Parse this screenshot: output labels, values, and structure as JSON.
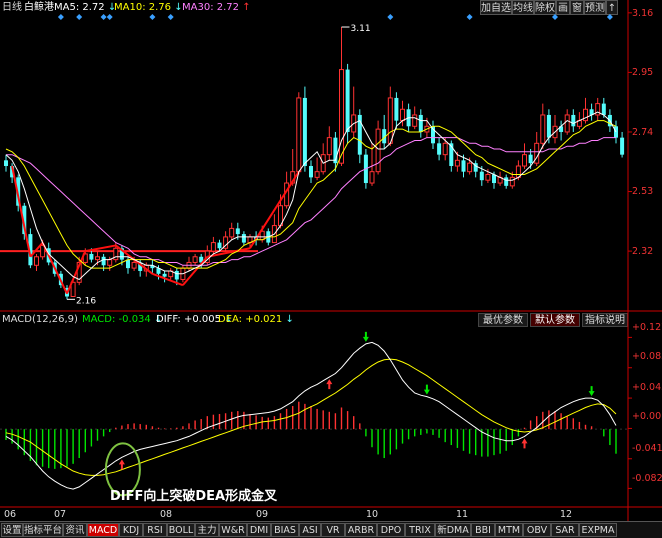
{
  "header": {
    "period": "日线",
    "stock_name": "白鲸港",
    "ma5_label": "MA5:",
    "ma5_value": "2.72",
    "ma10_label": "MA10:",
    "ma10_value": "2.76",
    "ma30_label": "MA30:",
    "ma30_value": "2.72",
    "buttons": [
      "加自选",
      "均线",
      "除权",
      "画",
      "窗",
      "预测"
    ]
  },
  "price_axis": [
    "3.16",
    "2.95",
    "2.74",
    "2.53",
    "2.32"
  ],
  "price_markers": {
    "high": "3.11",
    "low": "2.16"
  },
  "macd_header": {
    "title": "MACD(12,26,9)",
    "macd_label": "MACD:",
    "macd_value": "-0.034",
    "diff_label": "DIFF:",
    "diff_value": "+0.005",
    "dea_label": "DEA:",
    "dea_value": "+0.021",
    "param_buttons": [
      "最优参数",
      "默认参数",
      "指标说明"
    ]
  },
  "macd_axis": [
    "+0.127",
    "+0.085",
    "+0.043",
    "+0.001",
    "-0.041",
    "-0.082"
  ],
  "date_axis": [
    "06",
    "07",
    "08",
    "09",
    "10",
    "11",
    "12"
  ],
  "annotation": "DIFF向上突破DEA形成金叉",
  "bottom_tabs": [
    "设置",
    "指标平台",
    "资讯",
    "MACD",
    "KDJ",
    "RSI",
    "BOLL",
    "主力",
    "W&R",
    "DMI",
    "BIAS",
    "ASI",
    "VR",
    "ARBR",
    "DPO",
    "TRIX",
    "新DMA",
    "BBI",
    "MTM",
    "OBV",
    "SAR",
    "EXPMA"
  ],
  "active_tab": "MACD",
  "colors": {
    "up": "#ff3232",
    "down": "#54fcfc",
    "ma5": "#ffffff",
    "ma10": "#ffff00",
    "ma30": "#ff80ff",
    "macd_up": "#ff3232",
    "macd_down": "#00e600",
    "signal_up": "#ff3232",
    "signal_down": "#00e600",
    "circle": "#7fc241"
  },
  "chart_data": [
    {
      "type": "candlestick",
      "title": "",
      "yaxis_ticks": [
        3.16,
        2.95,
        2.74,
        2.53,
        2.32
      ],
      "ylim": [
        2.13,
        3.17
      ],
      "x_tick_labels": [
        "06",
        "07",
        "08",
        "09",
        "10",
        "11",
        "12"
      ],
      "candles": [
        [
          2.64,
          2.62,
          2.66,
          2.6
        ],
        [
          2.62,
          2.58,
          2.63,
          2.56
        ],
        [
          2.58,
          2.48,
          2.59,
          2.46
        ],
        [
          2.48,
          2.38,
          2.49,
          2.36
        ],
        [
          2.38,
          2.27,
          2.4,
          2.26
        ],
        [
          2.27,
          2.3,
          2.31,
          2.25
        ],
        [
          2.3,
          2.34,
          2.36,
          2.29
        ],
        [
          2.33,
          2.28,
          2.35,
          2.27
        ],
        [
          2.28,
          2.24,
          2.29,
          2.23
        ],
        [
          2.24,
          2.2,
          2.25,
          2.19
        ],
        [
          2.19,
          2.16,
          2.2,
          2.15
        ],
        [
          2.16,
          2.21,
          2.22,
          2.16
        ],
        [
          2.21,
          2.28,
          2.3,
          2.2
        ],
        [
          2.28,
          2.31,
          2.33,
          2.27
        ],
        [
          2.31,
          2.29,
          2.33,
          2.28
        ],
        [
          2.29,
          2.3,
          2.32,
          2.27
        ],
        [
          2.3,
          2.27,
          2.31,
          2.25
        ],
        [
          2.27,
          2.29,
          2.3,
          2.25
        ],
        [
          2.29,
          2.33,
          2.35,
          2.28
        ],
        [
          2.33,
          2.29,
          2.34,
          2.27
        ],
        [
          2.29,
          2.26,
          2.3,
          2.24
        ],
        [
          2.26,
          2.28,
          2.3,
          2.25
        ],
        [
          2.28,
          2.25,
          2.29,
          2.23
        ],
        [
          2.25,
          2.27,
          2.28,
          2.23
        ],
        [
          2.27,
          2.26,
          2.29,
          2.24
        ],
        [
          2.26,
          2.24,
          2.27,
          2.22
        ],
        [
          2.24,
          2.23,
          2.25,
          2.21
        ],
        [
          2.23,
          2.25,
          2.26,
          2.22
        ],
        [
          2.25,
          2.22,
          2.26,
          2.2
        ],
        [
          2.22,
          2.26,
          2.27,
          2.21
        ],
        [
          2.26,
          2.28,
          2.3,
          2.25
        ],
        [
          2.28,
          2.3,
          2.31,
          2.27
        ],
        [
          2.3,
          2.28,
          2.31,
          2.26
        ],
        [
          2.28,
          2.32,
          2.34,
          2.27
        ],
        [
          2.32,
          2.35,
          2.37,
          2.31
        ],
        [
          2.35,
          2.33,
          2.36,
          2.32
        ],
        [
          2.33,
          2.37,
          2.39,
          2.32
        ],
        [
          2.37,
          2.4,
          2.42,
          2.36
        ],
        [
          2.4,
          2.38,
          2.42,
          2.36
        ],
        [
          2.38,
          2.35,
          2.39,
          2.34
        ],
        [
          2.35,
          2.37,
          2.38,
          2.33
        ],
        [
          2.37,
          2.36,
          2.39,
          2.34
        ],
        [
          2.36,
          2.39,
          2.41,
          2.35
        ],
        [
          2.39,
          2.35,
          2.4,
          2.34
        ],
        [
          2.35,
          2.41,
          2.45,
          2.35
        ],
        [
          2.41,
          2.48,
          2.52,
          2.4
        ],
        [
          2.48,
          2.56,
          2.6,
          2.47
        ],
        [
          2.56,
          2.6,
          2.68,
          2.55
        ],
        [
          2.6,
          2.86,
          2.88,
          2.59
        ],
        [
          2.86,
          2.62,
          2.9,
          2.6
        ],
        [
          2.62,
          2.58,
          2.64,
          2.56
        ],
        [
          2.58,
          2.6,
          2.65,
          2.57
        ],
        [
          2.6,
          2.66,
          2.7,
          2.59
        ],
        [
          2.66,
          2.72,
          2.76,
          2.64
        ],
        [
          2.72,
          2.63,
          2.74,
          2.6
        ],
        [
          2.63,
          2.96,
          3.11,
          2.62
        ],
        [
          2.96,
          2.74,
          2.98,
          2.7
        ],
        [
          2.74,
          2.8,
          2.9,
          2.72
        ],
        [
          2.8,
          2.66,
          2.82,
          2.63
        ],
        [
          2.66,
          2.56,
          2.68,
          2.54
        ],
        [
          2.56,
          2.6,
          2.7,
          2.55
        ],
        [
          2.6,
          2.75,
          2.78,
          2.59
        ],
        [
          2.75,
          2.7,
          2.8,
          2.68
        ],
        [
          2.7,
          2.86,
          2.9,
          2.69
        ],
        [
          2.86,
          2.78,
          2.88,
          2.75
        ],
        [
          2.78,
          2.82,
          2.85,
          2.76
        ],
        [
          2.82,
          2.76,
          2.84,
          2.74
        ],
        [
          2.76,
          2.8,
          2.83,
          2.75
        ],
        [
          2.8,
          2.74,
          2.82,
          2.72
        ],
        [
          2.74,
          2.76,
          2.79,
          2.72
        ],
        [
          2.76,
          2.7,
          2.78,
          2.68
        ],
        [
          2.7,
          2.66,
          2.72,
          2.64
        ],
        [
          2.66,
          2.7,
          2.72,
          2.64
        ],
        [
          2.7,
          2.62,
          2.71,
          2.6
        ],
        [
          2.62,
          2.64,
          2.67,
          2.6
        ],
        [
          2.64,
          2.6,
          2.66,
          2.58
        ],
        [
          2.6,
          2.63,
          2.65,
          2.59
        ],
        [
          2.63,
          2.6,
          2.64,
          2.58
        ],
        [
          2.6,
          2.57,
          2.62,
          2.55
        ],
        [
          2.57,
          2.59,
          2.61,
          2.56
        ],
        [
          2.59,
          2.56,
          2.6,
          2.54
        ],
        [
          2.56,
          2.58,
          2.6,
          2.55
        ],
        [
          2.58,
          2.55,
          2.59,
          2.54
        ],
        [
          2.55,
          2.58,
          2.6,
          2.54
        ],
        [
          2.58,
          2.62,
          2.64,
          2.57
        ],
        [
          2.62,
          2.66,
          2.7,
          2.61
        ],
        [
          2.66,
          2.63,
          2.68,
          2.61
        ],
        [
          2.63,
          2.7,
          2.74,
          2.62
        ],
        [
          2.7,
          2.8,
          2.84,
          2.68
        ],
        [
          2.8,
          2.72,
          2.82,
          2.7
        ],
        [
          2.72,
          2.76,
          2.8,
          2.7
        ],
        [
          2.76,
          2.74,
          2.78,
          2.71
        ],
        [
          2.74,
          2.8,
          2.82,
          2.73
        ],
        [
          2.8,
          2.76,
          2.82,
          2.74
        ],
        [
          2.76,
          2.78,
          2.81,
          2.75
        ],
        [
          2.78,
          2.82,
          2.86,
          2.77
        ],
        [
          2.82,
          2.8,
          2.84,
          2.78
        ],
        [
          2.8,
          2.84,
          2.86,
          2.78
        ],
        [
          2.84,
          2.8,
          2.86,
          2.79
        ],
        [
          2.8,
          2.76,
          2.82,
          2.74
        ],
        [
          2.76,
          2.72,
          2.78,
          2.7
        ],
        [
          2.72,
          2.66,
          2.74,
          2.65
        ]
      ],
      "ma5": [
        2.66,
        2.64,
        2.6,
        2.54,
        2.47,
        2.4,
        2.35,
        2.31,
        2.29,
        2.27,
        2.25,
        2.23,
        2.22,
        2.24,
        2.26,
        2.28,
        2.29,
        2.29,
        2.3,
        2.3,
        2.3,
        2.29,
        2.28,
        2.27,
        2.27,
        2.26,
        2.25,
        2.25,
        2.24,
        2.24,
        2.25,
        2.26,
        2.27,
        2.29,
        2.31,
        2.32,
        2.34,
        2.36,
        2.37,
        2.37,
        2.37,
        2.37,
        2.37,
        2.37,
        2.38,
        2.41,
        2.45,
        2.5,
        2.6,
        2.63,
        2.65,
        2.67,
        2.63,
        2.64,
        2.64,
        2.71,
        2.75,
        2.77,
        2.78,
        2.74,
        2.7,
        2.68,
        2.68,
        2.7,
        2.76,
        2.78,
        2.79,
        2.79,
        2.78,
        2.78,
        2.75,
        2.73,
        2.71,
        2.69,
        2.66,
        2.65,
        2.64,
        2.62,
        2.61,
        2.6,
        2.59,
        2.58,
        2.57,
        2.57,
        2.58,
        2.6,
        2.62,
        2.65,
        2.69,
        2.72,
        2.74,
        2.76,
        2.78,
        2.77,
        2.78,
        2.79,
        2.8,
        2.81,
        2.8,
        2.78,
        2.74
      ],
      "ma10": [
        2.68,
        2.67,
        2.65,
        2.62,
        2.58,
        2.54,
        2.5,
        2.46,
        2.42,
        2.38,
        2.34,
        2.31,
        2.29,
        2.27,
        2.26,
        2.26,
        2.26,
        2.26,
        2.27,
        2.28,
        2.29,
        2.29,
        2.29,
        2.29,
        2.29,
        2.28,
        2.28,
        2.27,
        2.26,
        2.26,
        2.26,
        2.26,
        2.26,
        2.26,
        2.27,
        2.28,
        2.29,
        2.31,
        2.32,
        2.34,
        2.35,
        2.36,
        2.36,
        2.37,
        2.37,
        2.38,
        2.4,
        2.42,
        2.47,
        2.5,
        2.53,
        2.56,
        2.57,
        2.59,
        2.61,
        2.66,
        2.7,
        2.72,
        2.71,
        2.69,
        2.68,
        2.7,
        2.72,
        2.74,
        2.75,
        2.75,
        2.74,
        2.74,
        2.74,
        2.75,
        2.76,
        2.76,
        2.75,
        2.74,
        2.72,
        2.7,
        2.68,
        2.66,
        2.65,
        2.63,
        2.62,
        2.61,
        2.6,
        2.59,
        2.59,
        2.59,
        2.6,
        2.61,
        2.63,
        2.65,
        2.67,
        2.69,
        2.71,
        2.73,
        2.74,
        2.76,
        2.77,
        2.78,
        2.78,
        2.77,
        2.76
      ],
      "ma30": [
        2.66,
        2.66,
        2.65,
        2.64,
        2.63,
        2.61,
        2.59,
        2.57,
        2.55,
        2.53,
        2.51,
        2.49,
        2.47,
        2.45,
        2.43,
        2.41,
        2.39,
        2.37,
        2.35,
        2.34,
        2.33,
        2.31,
        2.3,
        2.3,
        2.29,
        2.29,
        2.28,
        2.28,
        2.28,
        2.27,
        2.27,
        2.27,
        2.27,
        2.27,
        2.28,
        2.28,
        2.28,
        2.29,
        2.29,
        2.3,
        2.3,
        2.31,
        2.32,
        2.33,
        2.34,
        2.35,
        2.36,
        2.38,
        2.4,
        2.42,
        2.43,
        2.45,
        2.47,
        2.49,
        2.51,
        2.54,
        2.56,
        2.58,
        2.6,
        2.61,
        2.62,
        2.63,
        2.65,
        2.66,
        2.68,
        2.69,
        2.7,
        2.71,
        2.71,
        2.72,
        2.72,
        2.72,
        2.72,
        2.72,
        2.72,
        2.71,
        2.7,
        2.7,
        2.69,
        2.69,
        2.68,
        2.68,
        2.67,
        2.67,
        2.67,
        2.67,
        2.67,
        2.67,
        2.67,
        2.68,
        2.68,
        2.68,
        2.69,
        2.69,
        2.7,
        2.7,
        2.71,
        2.71,
        2.72,
        2.72,
        2.72
      ]
    },
    {
      "type": "bar",
      "title": "MACD(12,26,9)",
      "yaxis_ticks": [
        0.127,
        0.085,
        0.043,
        0.001,
        -0.041,
        -0.082
      ],
      "ylim": [
        -0.105,
        0.14
      ],
      "macd": [
        -0.015,
        -0.02,
        -0.028,
        -0.036,
        -0.044,
        -0.05,
        -0.052,
        -0.054,
        -0.055,
        -0.054,
        -0.052,
        -0.048,
        -0.04,
        -0.032,
        -0.024,
        -0.016,
        -0.01,
        -0.004,
        0.002,
        0.005,
        0.007,
        0.008,
        0.007,
        0.006,
        0.004,
        0.002,
        0.001,
        0.001,
        0.002,
        0.004,
        0.008,
        0.012,
        0.014,
        0.018,
        0.02,
        0.021,
        0.022,
        0.024,
        0.025,
        0.024,
        0.021,
        0.019,
        0.017,
        0.016,
        0.018,
        0.022,
        0.028,
        0.032,
        0.038,
        0.035,
        0.032,
        0.028,
        0.026,
        0.024,
        0.022,
        0.03,
        0.025,
        0.018,
        0.008,
        -0.01,
        -0.025,
        -0.035,
        -0.04,
        -0.035,
        -0.028,
        -0.02,
        -0.014,
        -0.01,
        -0.008,
        -0.006,
        -0.008,
        -0.012,
        -0.018,
        -0.022,
        -0.026,
        -0.03,
        -0.034,
        -0.036,
        -0.038,
        -0.038,
        -0.036,
        -0.034,
        -0.03,
        -0.022,
        -0.01,
        0.002,
        0.012,
        0.018,
        0.024,
        0.026,
        0.025,
        0.022,
        0.018,
        0.015,
        0.01,
        0.006,
        0.004,
        0.0,
        -0.01,
        -0.022,
        -0.034
      ],
      "diff": [
        -0.01,
        -0.015,
        -0.022,
        -0.03,
        -0.038,
        -0.048,
        -0.058,
        -0.066,
        -0.072,
        -0.077,
        -0.081,
        -0.083,
        -0.08,
        -0.074,
        -0.068,
        -0.062,
        -0.056,
        -0.05,
        -0.044,
        -0.039,
        -0.035,
        -0.031,
        -0.028,
        -0.026,
        -0.024,
        -0.022,
        -0.02,
        -0.018,
        -0.016,
        -0.013,
        -0.01,
        -0.006,
        -0.002,
        0.002,
        0.005,
        0.008,
        0.011,
        0.014,
        0.017,
        0.019,
        0.02,
        0.021,
        0.022,
        0.023,
        0.025,
        0.028,
        0.033,
        0.038,
        0.046,
        0.053,
        0.058,
        0.062,
        0.067,
        0.072,
        0.077,
        0.085,
        0.095,
        0.105,
        0.112,
        0.118,
        0.12,
        0.116,
        0.108,
        0.096,
        0.082,
        0.068,
        0.058,
        0.05,
        0.047,
        0.045,
        0.042,
        0.038,
        0.032,
        0.026,
        0.02,
        0.014,
        0.008,
        0.002,
        -0.004,
        -0.008,
        -0.012,
        -0.014,
        -0.016,
        -0.016,
        -0.014,
        -0.01,
        -0.004,
        0.002,
        0.01,
        0.018,
        0.024,
        0.03,
        0.034,
        0.038,
        0.041,
        0.043,
        0.043,
        0.04,
        0.032,
        0.02,
        0.005
      ],
      "dea": [
        -0.005,
        -0.007,
        -0.01,
        -0.014,
        -0.018,
        -0.024,
        -0.03,
        -0.036,
        -0.042,
        -0.048,
        -0.053,
        -0.058,
        -0.061,
        -0.063,
        -0.064,
        -0.064,
        -0.063,
        -0.061,
        -0.059,
        -0.056,
        -0.053,
        -0.05,
        -0.047,
        -0.044,
        -0.041,
        -0.038,
        -0.035,
        -0.032,
        -0.029,
        -0.026,
        -0.023,
        -0.02,
        -0.017,
        -0.014,
        -0.011,
        -0.008,
        -0.005,
        -0.002,
        0.001,
        0.004,
        0.006,
        0.008,
        0.01,
        0.011,
        0.012,
        0.014,
        0.016,
        0.019,
        0.022,
        0.027,
        0.031,
        0.035,
        0.04,
        0.045,
        0.05,
        0.056,
        0.062,
        0.069,
        0.075,
        0.082,
        0.088,
        0.093,
        0.096,
        0.097,
        0.096,
        0.093,
        0.089,
        0.084,
        0.079,
        0.074,
        0.068,
        0.062,
        0.056,
        0.05,
        0.044,
        0.038,
        0.032,
        0.026,
        0.02,
        0.015,
        0.01,
        0.006,
        0.002,
        -0.001,
        -0.003,
        -0.004,
        -0.003,
        -0.001,
        0.002,
        0.006,
        0.01,
        0.014,
        0.018,
        0.022,
        0.026,
        0.03,
        0.033,
        0.035,
        0.034,
        0.029,
        0.021
      ],
      "golden_cross_index": 19,
      "up_signal_indices": [
        19,
        53,
        85
      ],
      "down_signal_indices": [
        59,
        69,
        96
      ]
    }
  ]
}
